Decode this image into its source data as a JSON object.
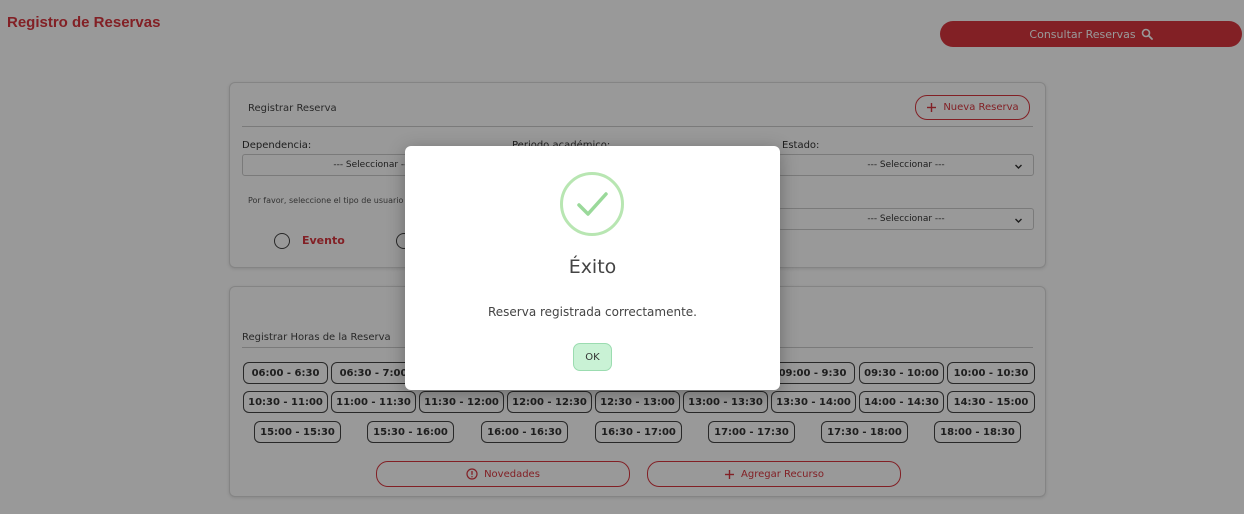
{
  "header": {
    "title": "Registro de Reservas",
    "consult_label": "Consultar Reservas"
  },
  "registrar": {
    "title": "Registrar Reserva",
    "new_label": "Nueva Reserva",
    "dependencia_label": "Dependencia:",
    "dependencia_value": "--- Seleccionar ---",
    "periodo_label": "Periodo académico:",
    "estado_label": "Estado:",
    "estado_value": "--- Seleccionar ---",
    "user_type_prompt": "Por favor, seleccione el tipo de usuario",
    "second_select_value": "--- Seleccionar ---",
    "radio_evento_label": "Evento"
  },
  "horas": {
    "title": "Registrar Horas de la Reserva",
    "slots": [
      "06:00 - 6:30",
      "06:30 - 7:00",
      "09:00 - 9:30",
      "09:30 - 10:00",
      "10:00 - 10:30",
      "10:30 - 11:00",
      "11:00 - 11:30",
      "11:30 - 12:00",
      "12:00 - 12:30",
      "12:30 - 13:00",
      "13:00 - 13:30",
      "13:30 - 14:00",
      "14:00 - 14:30",
      "14:30 - 15:00",
      "15:00 - 15:30",
      "15:30 - 16:00",
      "16:00 - 16:30",
      "16:30 - 17:00",
      "17:00 - 17:30",
      "17:30 - 18:00",
      "18:00 - 18:30"
    ],
    "novedades_label": "Novedades",
    "agregar_label": "Agregar Recurso"
  },
  "modal": {
    "title": "Éxito",
    "message": "Reserva registrada correctamente.",
    "ok_label": "OK"
  },
  "colors": {
    "accent": "#d9363f",
    "success": "#9ad99a",
    "overlay": "rgba(0,0,0,0.4)"
  },
  "icons": [
    "search-icon",
    "plus-icon",
    "chevron-down-icon",
    "alert-circle-icon",
    "check-icon"
  ]
}
